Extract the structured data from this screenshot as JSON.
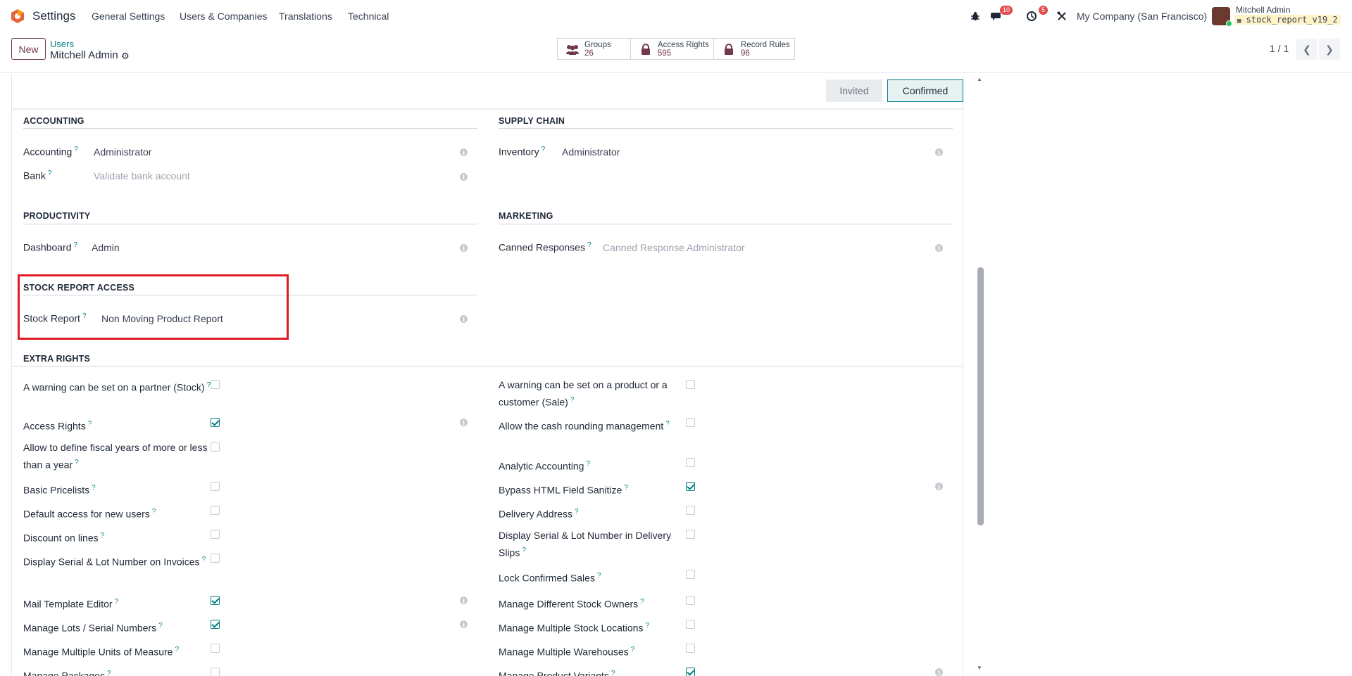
{
  "navbar": {
    "app_name": "Settings",
    "menu": [
      "General Settings",
      "Users & Companies",
      "Translations",
      "Technical"
    ],
    "messages_badge": "10",
    "activities_badge": "5",
    "company": "My Company (San Francisco)",
    "user_name": "Mitchell Admin",
    "database": "stock_report_v19_2",
    "icons": [
      "bug-icon",
      "chat-icon",
      "clock-icon",
      "tools-icon"
    ]
  },
  "control_panel": {
    "new_label": "New",
    "breadcrumb_parent": "Users",
    "breadcrumb_current": "Mitchell Admin",
    "smart_buttons": [
      {
        "label": "Groups",
        "value": "26",
        "icon": "users-icon"
      },
      {
        "label": "Access Rights",
        "value": "595",
        "icon": "lock-icon"
      },
      {
        "label": "Record Rules",
        "value": "96",
        "icon": "lock-icon"
      }
    ],
    "pager": "1 / 1"
  },
  "status": {
    "stages": [
      "Invited",
      "Confirmed"
    ],
    "current": "Confirmed"
  },
  "sections": {
    "accounting": {
      "title": "ACCOUNTING",
      "fields": [
        {
          "label": "Accounting",
          "value": "Administrator",
          "muted": false
        },
        {
          "label": "Bank",
          "value": "Validate bank account",
          "muted": true
        }
      ]
    },
    "supply_chain": {
      "title": "SUPPLY CHAIN",
      "fields": [
        {
          "label": "Inventory",
          "value": "Administrator",
          "muted": false
        }
      ]
    },
    "productivity": {
      "title": "PRODUCTIVITY",
      "fields": [
        {
          "label": "Dashboard",
          "value": "Admin",
          "muted": false
        }
      ]
    },
    "marketing": {
      "title": "MARKETING",
      "fields": [
        {
          "label": "Canned Responses",
          "value": "Canned Response Administrator",
          "muted": true
        }
      ]
    },
    "stock_report": {
      "title": "STOCK REPORT ACCESS",
      "fields": [
        {
          "label": "Stock Report",
          "value": "Non Moving Product Report",
          "muted": false
        }
      ]
    },
    "extra_rights": {
      "title": "EXTRA RIGHTS",
      "left": [
        {
          "label": "A warning can be set on a partner (Stock)",
          "checked": false
        },
        {
          "label": "Access Rights",
          "checked": true
        },
        {
          "label": "Allow to define fiscal years of more or less than a year",
          "checked": false
        },
        {
          "label": "Basic Pricelists",
          "checked": false
        },
        {
          "label": "Default access for new users",
          "checked": false
        },
        {
          "label": "Discount on lines",
          "checked": false
        },
        {
          "label": "Display Serial & Lot Number on Invoices",
          "checked": false
        },
        {
          "label": "Mail Template Editor",
          "checked": true
        },
        {
          "label": "Manage Lots / Serial Numbers",
          "checked": true
        },
        {
          "label": "Manage Multiple Units of Measure",
          "checked": false
        },
        {
          "label": "Manage Packages",
          "checked": false
        }
      ],
      "right": [
        {
          "label": "A warning can be set on a product or a customer (Sale)",
          "checked": false
        },
        {
          "label": "Allow the cash rounding management",
          "checked": false
        },
        {
          "label": "Analytic Accounting",
          "checked": false
        },
        {
          "label": "Bypass HTML Field Sanitize",
          "checked": true
        },
        {
          "label": "Delivery Address",
          "checked": false
        },
        {
          "label": "Display Serial & Lot Number in Delivery Slips",
          "checked": false
        },
        {
          "label": "Lock Confirmed Sales",
          "checked": false
        },
        {
          "label": "Manage Different Stock Owners",
          "checked": false
        },
        {
          "label": "Manage Multiple Stock Locations",
          "checked": false
        },
        {
          "label": "Manage Multiple Warehouses",
          "checked": false
        },
        {
          "label": "Manage Product Variants",
          "checked": true
        }
      ]
    }
  }
}
